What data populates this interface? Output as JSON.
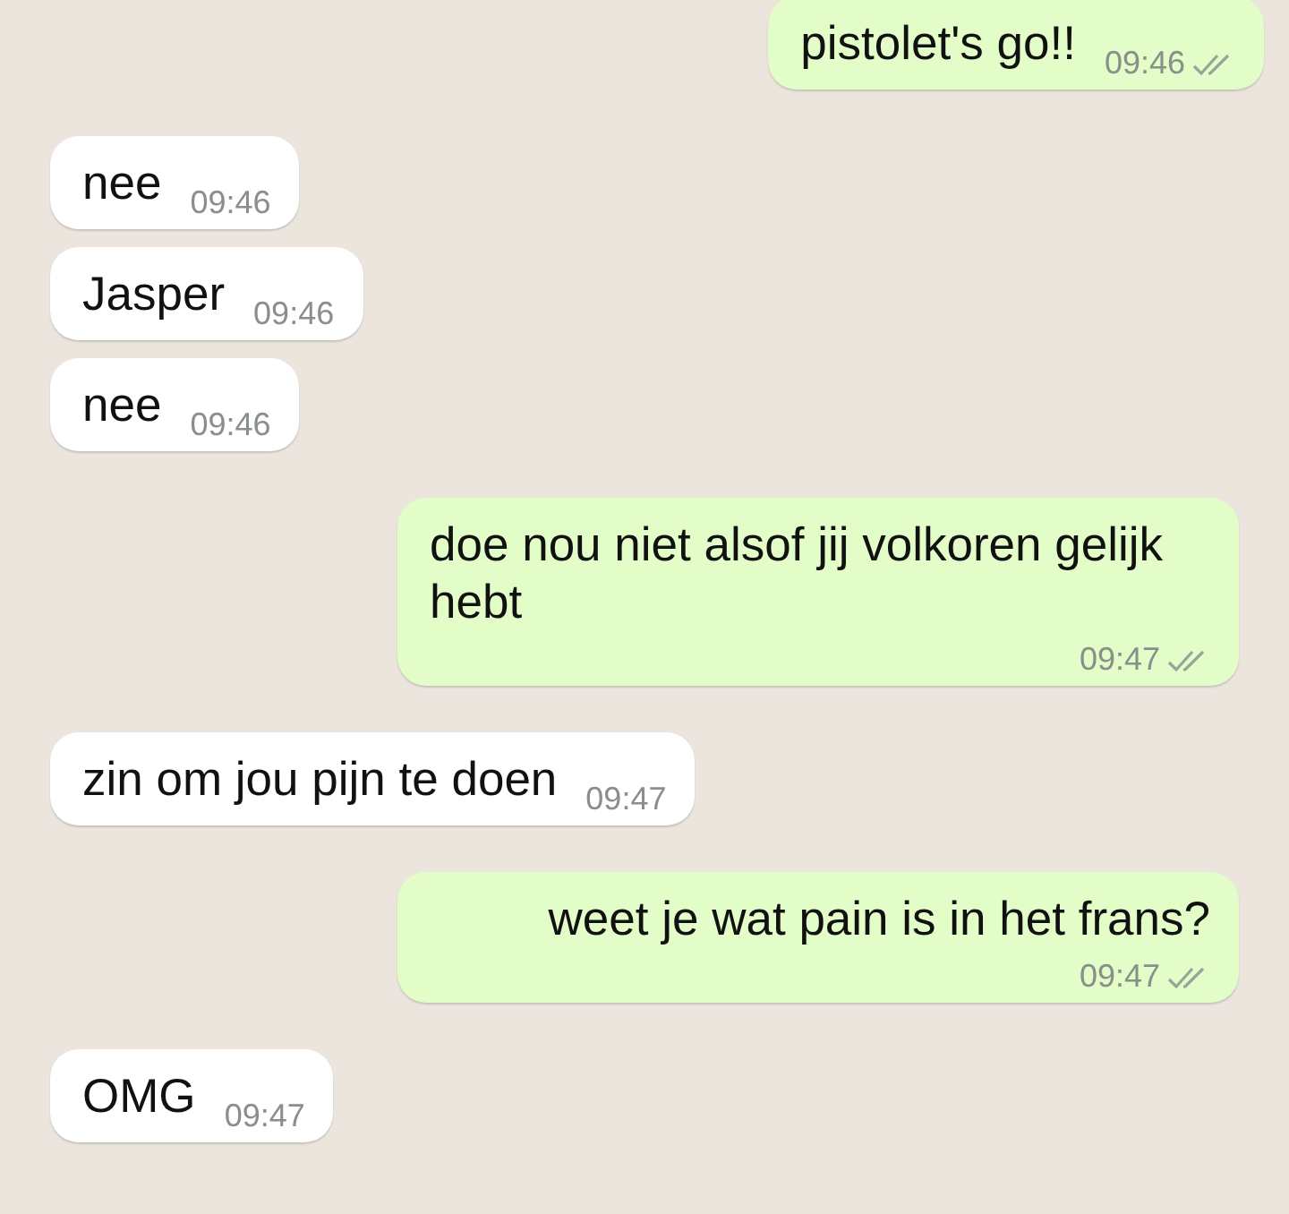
{
  "messages": [
    {
      "kind": "outgoing",
      "text": "pistolet's go!!",
      "time": "09:46",
      "read": false
    },
    {
      "kind": "incoming",
      "text": "nee",
      "time": "09:46"
    },
    {
      "kind": "incoming",
      "text": "Jasper",
      "time": "09:46"
    },
    {
      "kind": "incoming",
      "text": "nee",
      "time": "09:46"
    },
    {
      "kind": "outgoing",
      "text": "doe nou niet alsof jij volkoren gelijk hebt",
      "time": "09:47",
      "read": false
    },
    {
      "kind": "incoming",
      "text": "zin om jou pijn te doen",
      "time": "09:47"
    },
    {
      "kind": "outgoing",
      "text": "weet je wat pain is in het frans?",
      "time": "09:47",
      "read": false
    },
    {
      "kind": "incoming",
      "text": "OMG",
      "time": "09:47"
    }
  ]
}
